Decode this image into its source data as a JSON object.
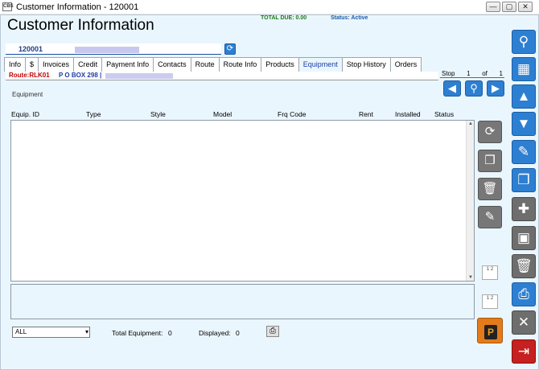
{
  "window": {
    "title": "Customer Information - 120001",
    "app_icon": "cbs-app-icon",
    "controls": [
      "—",
      "▢",
      "✕"
    ]
  },
  "header": {
    "title": "Customer Information",
    "total_due": "TOTAL DUE:  0.00",
    "status": "Status: Active"
  },
  "account": {
    "number": "120001"
  },
  "tabs": [
    "Info",
    "$",
    "Invoices",
    "Credit",
    "Payment Info",
    "Contacts",
    "Route",
    "Route Info",
    "Products",
    "Equipment",
    "Stop History",
    "Orders"
  ],
  "active_tab": "Equipment",
  "route": {
    "label": "Route:RLK01",
    "address": "P O BOX 298 |"
  },
  "stop": {
    "label": "Stop",
    "current": "1",
    "of_label": "of",
    "total": "1"
  },
  "equipment_section_label": "Equipment",
  "table": {
    "columns": [
      "Equip. ID",
      "Type",
      "Style",
      "Model",
      "Frq Code",
      "Rent",
      "Installed",
      "Status"
    ],
    "rows": []
  },
  "footer": {
    "filter_value": "ALL",
    "total_equipment_label": "Total Equipment:",
    "total_equipment_value": "0",
    "displayed_label": "Displayed:",
    "displayed_value": "0"
  },
  "side_buttons": {
    "print_badge": "P",
    "num_btn": "1 2"
  },
  "icons": {
    "right_toolbar": [
      "search-icon",
      "grid-icon",
      "arrow-up-icon",
      "arrow-down-icon",
      "edit-icon",
      "new-copy-icon",
      "add-new-icon",
      "save-icon",
      "delete-icon",
      "print-icon",
      "close-icon",
      "exit-icon"
    ]
  },
  "colors": {
    "accent_blue": "#2d7fd1",
    "route_red": "#c00000",
    "total_due_green": "#1a7a1a",
    "exit_red": "#c62020",
    "print_orange": "#e37b1a"
  }
}
